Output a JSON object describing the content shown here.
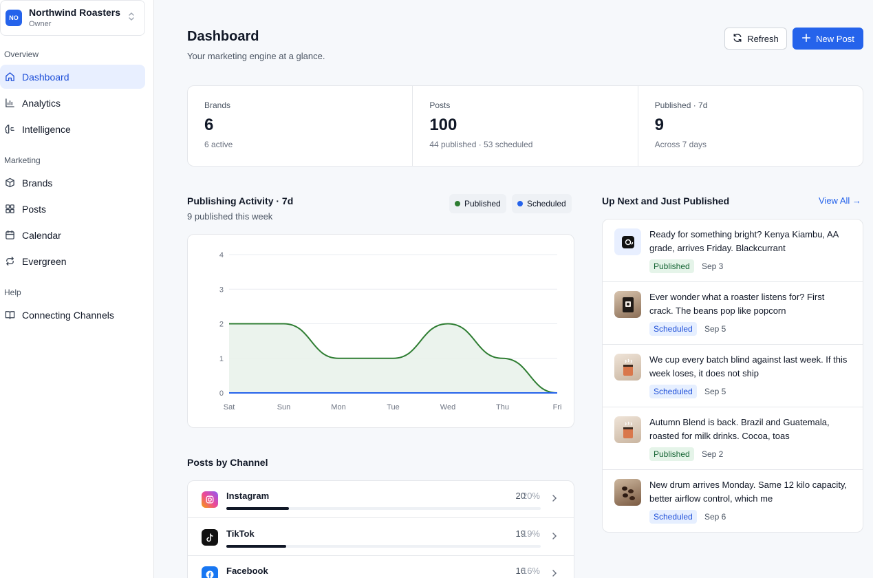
{
  "org": {
    "initials": "NO",
    "name": "Northwind Roasters",
    "role": "Owner"
  },
  "sidebar": {
    "sections": [
      {
        "label": "Overview",
        "items": [
          {
            "label": "Dashboard",
            "icon": "home-icon",
            "active": true
          },
          {
            "label": "Analytics",
            "icon": "bar-chart-icon"
          },
          {
            "label": "Intelligence",
            "icon": "brain-icon"
          }
        ]
      },
      {
        "label": "Marketing",
        "items": [
          {
            "label": "Brands",
            "icon": "box-icon"
          },
          {
            "label": "Posts",
            "icon": "grid-icon"
          },
          {
            "label": "Calendar",
            "icon": "calendar-icon"
          },
          {
            "label": "Evergreen",
            "icon": "repeat-icon"
          }
        ]
      },
      {
        "label": "Help",
        "items": [
          {
            "label": "Connecting Channels",
            "icon": "book-icon"
          }
        ]
      }
    ]
  },
  "header": {
    "title": "Dashboard",
    "subtitle": "Your marketing engine at a glance.",
    "refresh_label": "Refresh",
    "new_post_label": "New Post"
  },
  "stats": [
    {
      "label": "Brands",
      "value": "6",
      "sub": "6 active"
    },
    {
      "label": "Posts",
      "value": "100",
      "sub": "44 published · 53 scheduled"
    },
    {
      "label": "Published · 7d",
      "value": "9",
      "sub": "Across 7 days"
    }
  ],
  "activity": {
    "title": "Publishing Activity · 7d",
    "subtitle": "9 published this week",
    "legend_published": "Published",
    "legend_scheduled": "Scheduled"
  },
  "chart_data": {
    "type": "area",
    "title": "Publishing Activity · 7d",
    "categories": [
      "Sat",
      "Sun",
      "Mon",
      "Tue",
      "Wed",
      "Thu",
      "Fri"
    ],
    "series": [
      {
        "name": "Published",
        "values": [
          2,
          2,
          1,
          1,
          2,
          1,
          0
        ],
        "color": "#2e7d32"
      },
      {
        "name": "Scheduled",
        "values": [
          0,
          0,
          0,
          0,
          0,
          0,
          0
        ],
        "color": "#2563eb"
      }
    ],
    "ylim": [
      0,
      4
    ],
    "yticks": [
      0,
      1,
      2,
      3,
      4
    ],
    "grid": true
  },
  "channels": {
    "title": "Posts by Channel",
    "rows": [
      {
        "name": "Instagram",
        "count": "20",
        "pct": "20%",
        "fraction": 0.2
      },
      {
        "name": "TikTok",
        "count": "19",
        "pct": "19%",
        "fraction": 0.19
      },
      {
        "name": "Facebook",
        "count": "16",
        "pct": "16%",
        "fraction": 0.16
      }
    ]
  },
  "up_next": {
    "title": "Up Next and Just Published",
    "view_all": "View All →",
    "posts": [
      {
        "text": "Ready for something bright? Kenya Kiambu, AA grade, arrives Friday. Blackcurrant",
        "status": "Published",
        "date": "Sep 3"
      },
      {
        "text": "Ever wonder what a roaster listens for? First crack. The beans pop like popcorn",
        "status": "Scheduled",
        "date": "Sep 5"
      },
      {
        "text": "We cup every batch blind against last week. If this week loses, it does not ship",
        "status": "Scheduled",
        "date": "Sep 5"
      },
      {
        "text": "Autumn Blend is back. Brazil and Guatemala, roasted for milk drinks. Cocoa, toas",
        "status": "Published",
        "date": "Sep 2"
      },
      {
        "text": "New drum arrives Monday. Same 12 kilo capacity, better airflow control, which me",
        "status": "Scheduled",
        "date": "Sep 6"
      }
    ]
  }
}
